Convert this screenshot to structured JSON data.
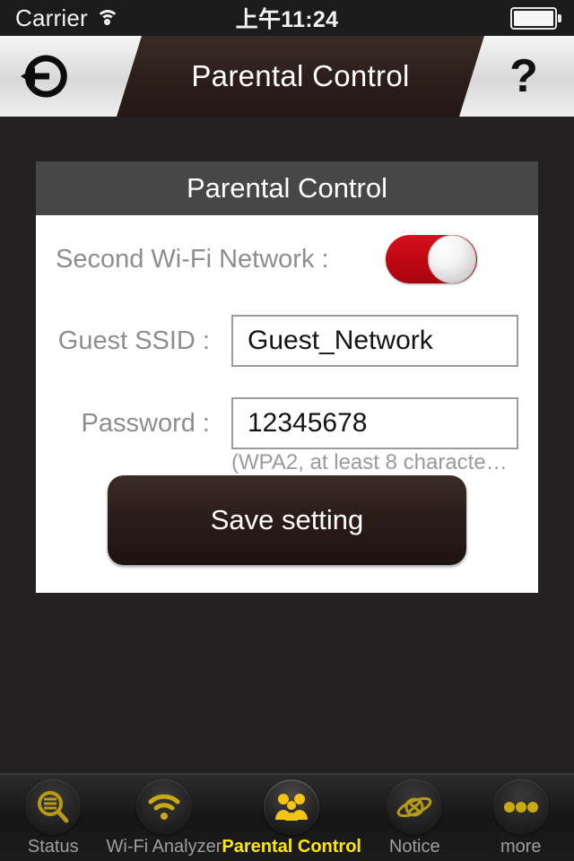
{
  "status_bar": {
    "carrier": "Carrier",
    "time": "上午11:24",
    "wifi_icon": "wifi-icon",
    "battery_icon": "battery-full-icon"
  },
  "nav_bar": {
    "title": "Parental Control",
    "back_icon": "back-arrow-icon",
    "help_label": "?"
  },
  "card": {
    "header_title": "Parental Control",
    "toggle_row": {
      "label": "Second Wi-Fi Network :",
      "state": "on"
    },
    "ssid_row": {
      "label": "Guest SSID :",
      "value": "Guest_Network"
    },
    "password_row": {
      "label": "Password :",
      "value": "12345678",
      "hint": "(WPA2, at least 8 characte…"
    },
    "save_button": "Save setting"
  },
  "tab_bar": {
    "active_index": 2,
    "items": [
      {
        "label": "Status",
        "icon": "magnifier-list-icon"
      },
      {
        "label": "Wi-Fi Analyzer",
        "icon": "wifi-signal-icon"
      },
      {
        "label": "Parental Control",
        "icon": "family-people-icon"
      },
      {
        "label": "Notice",
        "icon": "atom-orbit-icon"
      },
      {
        "label": "more",
        "icon": "three-dots-icon"
      }
    ]
  },
  "colors": {
    "accent_yellow": "#ffe800",
    "toggle_on_red": "#c00813",
    "page_background": "#232122",
    "card_header": "#474747"
  }
}
